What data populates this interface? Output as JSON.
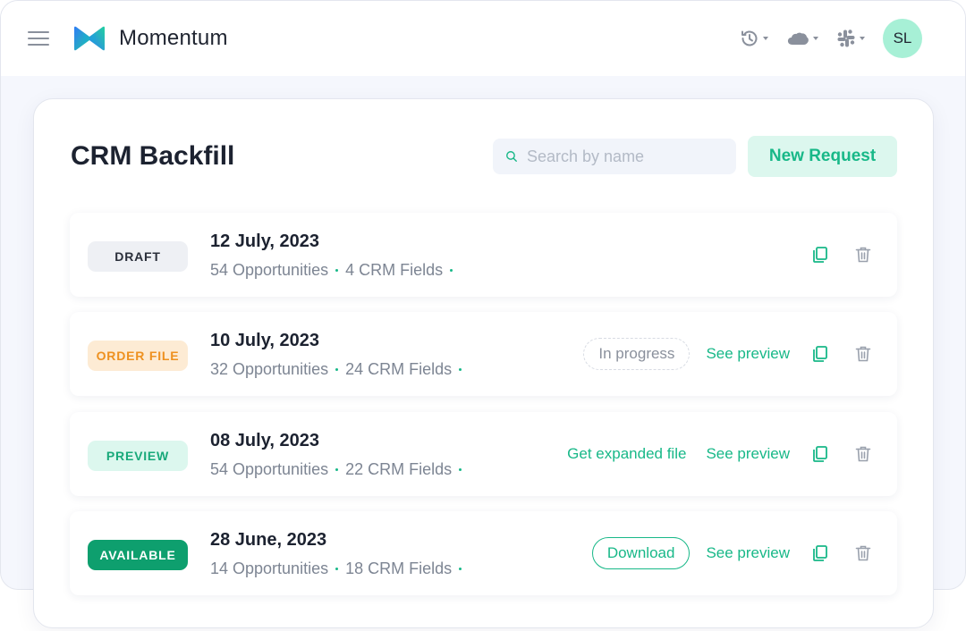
{
  "app": {
    "brand": "Momentum"
  },
  "header": {
    "avatar_initials": "SL",
    "icons": [
      "history-icon",
      "salesforce-cloud-icon",
      "slack-icon"
    ]
  },
  "page": {
    "title": "CRM Backfill",
    "search_placeholder": "Search by name",
    "new_button": "New Request"
  },
  "colors": {
    "accent": "#18b888",
    "draft_bg": "#eef0f4",
    "order_bg": "#fdebd4",
    "order_text": "#ee9120",
    "preview_bg": "#dcf7ee",
    "available_bg": "#0e9f6e",
    "avatar_bg": "#a7f0d6"
  },
  "requests": [
    {
      "status": "DRAFT",
      "date": "12 July, 2023",
      "opportunities": "54 Opportunities",
      "fields": "4 CRM Fields"
    },
    {
      "status": "ORDER FILE",
      "date": "10 July, 2023",
      "opportunities": "32 Opportunities",
      "fields": "24 CRM Fields",
      "progress_label": "In progress",
      "preview_link": "See preview"
    },
    {
      "status": "PREVIEW",
      "date": "08 July, 2023",
      "opportunities": "54 Opportunities",
      "fields": "22 CRM Fields",
      "expanded_link": "Get expanded file",
      "preview_link": "See preview"
    },
    {
      "status": "AVAILABLE",
      "date": "28 June, 2023",
      "opportunities": "14 Opportunities",
      "fields": "18 CRM Fields",
      "download_label": "Download",
      "preview_link": "See preview"
    }
  ]
}
